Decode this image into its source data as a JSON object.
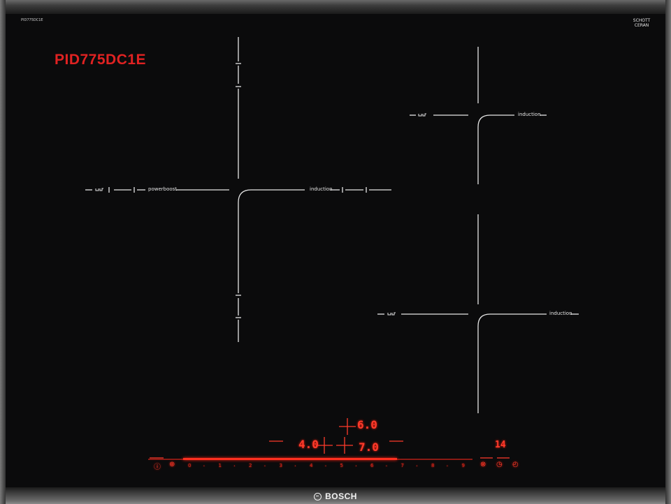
{
  "model": {
    "small_label": "PID775DC1E",
    "large_label": "PID775DC1E"
  },
  "brand": {
    "name": "BOSCH",
    "glass_brand": "SCHOTT",
    "glass_brand_sub": "CERAN"
  },
  "zones": {
    "left_flex": {
      "label_left": "powerboost",
      "label_right": "induction"
    },
    "right_top": {
      "label": "induction"
    },
    "right_bottom": {
      "label": "induction"
    }
  },
  "displays": {
    "top_center": "6.0",
    "mid_left": "4.0",
    "mid_right": "7.0",
    "timer": "14"
  },
  "slider": {
    "scale": [
      "0",
      "1",
      "2",
      "3",
      "4",
      "5",
      "6",
      "7",
      "8",
      "9"
    ]
  },
  "colors": {
    "glass": "#0b0b0c",
    "display_red": "#ff3b2b",
    "line_white": "#e6e6e6"
  },
  "icons": [
    "info-icon",
    "child-lock-icon",
    "powerboost-icon",
    "timer-icon",
    "clock-icon"
  ]
}
